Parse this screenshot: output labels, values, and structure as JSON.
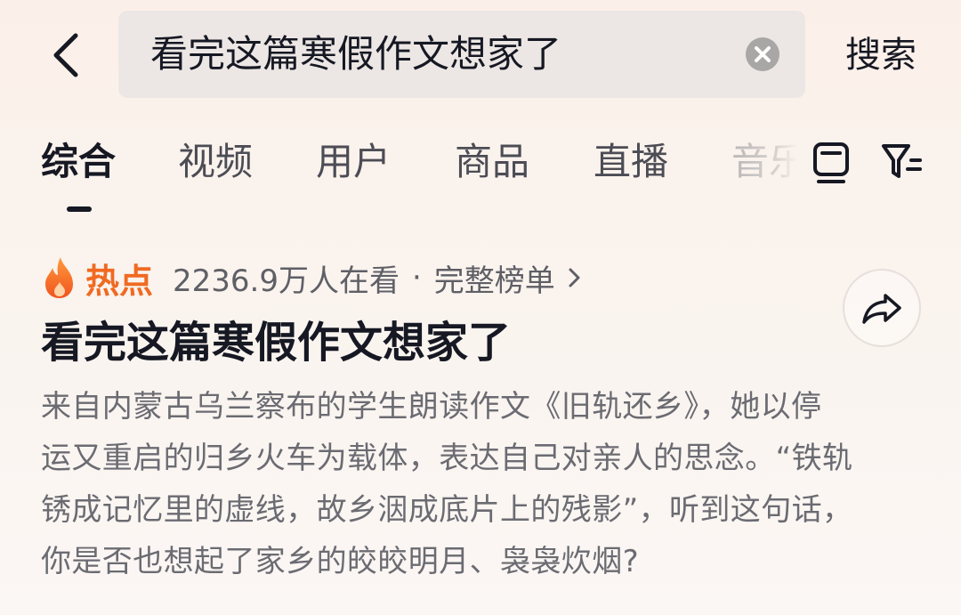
{
  "search": {
    "back_icon": "chevron-left-icon",
    "query": "看完这篇寒假作文想家了",
    "clear_icon": "close-circle-icon",
    "submit_label": "搜索"
  },
  "tabs": [
    {
      "label": "综合",
      "active": true
    },
    {
      "label": "视频",
      "active": false
    },
    {
      "label": "用户",
      "active": false
    },
    {
      "label": "商品",
      "active": false
    },
    {
      "label": "直播",
      "active": false
    },
    {
      "label": "音乐",
      "active": false
    }
  ],
  "toolbar": {
    "layout_icon": "layout-icon",
    "filter_icon": "filter-icon"
  },
  "hot": {
    "icon": "flame-icon",
    "label": "热点",
    "viewers": "2236.9万人在看",
    "separator": "·",
    "board_link": "完整榜单",
    "chevron_icon": "chevron-right-icon",
    "share_icon": "share-icon",
    "title": "看完这篇寒假作文想家了",
    "description_lines": [
      "来自内蒙古乌兰察布的学生朗读作文《旧轨还乡》，她以停",
      "运又重启的归乡火车为载体，表达自己对亲人的思念。“铁轨",
      "锈成记忆里的虚线，故乡洇成底片上的残影”，听到这句话，",
      "你是否也想起了家乡的皎皎明月、袅袅炊烟?"
    ]
  },
  "colors": {
    "accent_orange": "#f06a21",
    "text_primary": "#161823",
    "text_secondary": "#6b6b72",
    "search_bg": "#ece7e4"
  }
}
